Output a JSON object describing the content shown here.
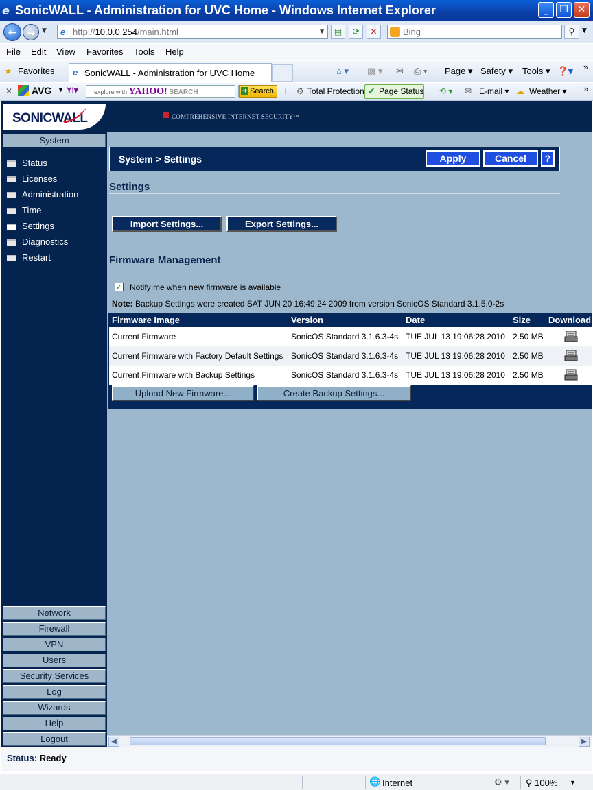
{
  "window": {
    "title": "SonicWALL - Administration for UVC Home - Windows Internet Explorer",
    "url_prefix": "http://",
    "url_host": "10.0.0.254",
    "url_path": "/main.html",
    "search_placeholder": "Bing"
  },
  "menu": [
    "File",
    "Edit",
    "View",
    "Favorites",
    "Tools",
    "Help"
  ],
  "favorites_bar": {
    "favorites_label": "Favorites",
    "tab_title": "SonicWALL - Administration for UVC Home",
    "page_label": "Page",
    "safety_label": "Safety",
    "tools_label": "Tools"
  },
  "avg_toolbar": {
    "avg_label": "AVG",
    "yahoo_explore": "explore with",
    "yahoo_brand": "YAHOO!",
    "yahoo_search": "SEARCH",
    "search_button": "Search",
    "total_protection": "Total Protection",
    "page_status": "Page Status",
    "email": "E-mail",
    "weather": "Weather"
  },
  "header": {
    "logo_text": "SONICWALL",
    "tagline": "COMPREHENSIVE INTERNET SECURITY™"
  },
  "sidebar": {
    "section": "System",
    "items": [
      "Status",
      "Licenses",
      "Administration",
      "Time",
      "Settings",
      "Diagnostics",
      "Restart"
    ],
    "bottom_buttons": [
      "Network",
      "Firewall",
      "VPN",
      "Users",
      "Security Services",
      "Log",
      "Wizards",
      "Help",
      "Logout"
    ]
  },
  "main": {
    "breadcrumb": "System > Settings",
    "apply_label": "Apply",
    "cancel_label": "Cancel",
    "help_label": "?",
    "settings_heading": "Settings",
    "import_label": "Import Settings...",
    "export_label": "Export Settings...",
    "firmware_heading": "Firmware Management",
    "notify_label": "Notify me when new firmware is available",
    "notify_checked": true,
    "note_label": "Note:",
    "note_text": "Backup Settings were created SAT JUN 20 16:49:24 2009 from version SonicOS Standard 3.1.5.0-2s",
    "table_headers": [
      "Firmware Image",
      "Version",
      "Date",
      "Size",
      "Download"
    ],
    "firmware_rows": [
      {
        "image": "Current Firmware",
        "version": "SonicOS Standard 3.1.6.3-4s",
        "date": "TUE JUL 13 19:06:28 2010",
        "size": "2.50 MB"
      },
      {
        "image": "Current Firmware with Factory Default Settings",
        "version": "SonicOS Standard 3.1.6.3-4s",
        "date": "TUE JUL 13 19:06:28 2010",
        "size": "2.50 MB"
      },
      {
        "image": "Current Firmware with Backup Settings",
        "version": "SonicOS Standard 3.1.6.3-4s",
        "date": "TUE JUL 13 19:06:28 2010",
        "size": "2.50 MB"
      }
    ],
    "upload_label": "Upload New Firmware...",
    "backup_label": "Create Backup Settings..."
  },
  "page_status": {
    "label": "Status:",
    "value": "Ready"
  },
  "ie_status": {
    "zone": "Internet",
    "zoom": "100%"
  },
  "colors": {
    "navy": "#04244f",
    "content_bg": "#9db8cc",
    "blue_button": "#1f4ee0"
  }
}
